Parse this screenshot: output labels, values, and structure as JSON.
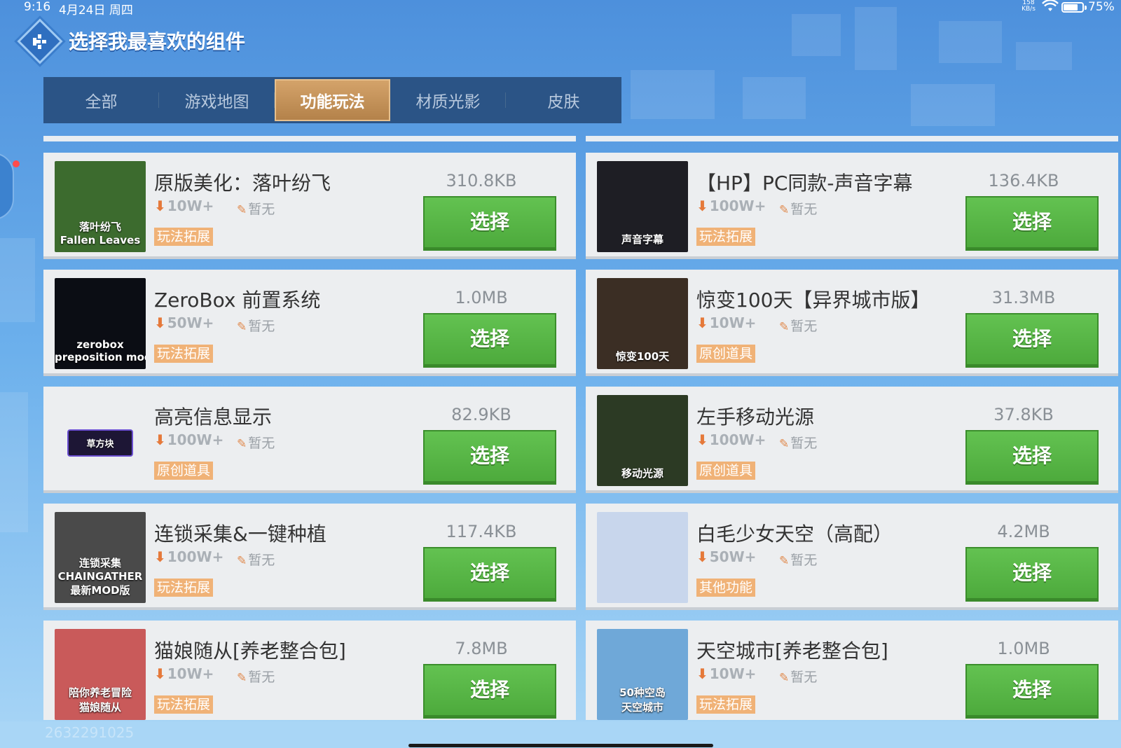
{
  "status_bar": {
    "time": "9:16",
    "date": "4月24日 周四",
    "net_speed": "158\nKB/s",
    "battery": "75%",
    "battery_level": 0.75
  },
  "header": {
    "title": "选择我最喜欢的组件"
  },
  "tabs": [
    {
      "label": "全部",
      "active": false
    },
    {
      "label": "游戏地图",
      "active": false
    },
    {
      "label": "功能玩法",
      "active": true
    },
    {
      "label": "材质光影",
      "active": false
    },
    {
      "label": "皮肤",
      "active": false
    }
  ],
  "items": [
    {
      "name": "原版美化：落叶纷飞",
      "downloads": "10W+",
      "rating": "暂无",
      "tag": "玩法拓展",
      "size": "310.8KB",
      "button": "选择",
      "thumb_caption": "落叶纷飞\nFallen Leaves",
      "thumb_color": "#3c6b2e"
    },
    {
      "name": "【HP】PC同款-声音字幕",
      "downloads": "100W+",
      "rating": "暂无",
      "tag": "玩法拓展",
      "size": "136.4KB",
      "button": "选择",
      "thumb_caption": "声音字幕",
      "thumb_color": "#1e1e24"
    },
    {
      "name": "ZeroBox 前置系统",
      "downloads": "50W+",
      "rating": "暂无",
      "tag": "玩法拓展",
      "size": "1.0MB",
      "button": "选择",
      "thumb_caption": "zerobox\npreposition mod",
      "thumb_color": "#0b0d14"
    },
    {
      "name": "惊变100天【异界城市版】",
      "downloads": "10W+",
      "rating": "暂无",
      "tag": "原创道具",
      "size": "31.3MB",
      "button": "选择",
      "thumb_caption": "惊变100天",
      "thumb_color": "#3b2e24"
    },
    {
      "name": "高亮信息显示",
      "downloads": "100W+",
      "rating": "暂无",
      "tag": "原创道具",
      "size": "82.9KB",
      "button": "选择",
      "thumb_caption": "草方块",
      "thumb_color": "#eceef0"
    },
    {
      "name": "左手移动光源",
      "downloads": "100W+",
      "rating": "暂无",
      "tag": "原创道具",
      "size": "37.8KB",
      "button": "选择",
      "thumb_caption": "移动光源",
      "thumb_color": "#2c3a24"
    },
    {
      "name": "连锁采集&一键种植",
      "downloads": "100W+",
      "rating": "暂无",
      "tag": "玩法拓展",
      "size": "117.4KB",
      "button": "选择",
      "thumb_caption": "连锁采集\nCHAINGATHER\n最新MOD版",
      "thumb_color": "#4a4a4a"
    },
    {
      "name": "白毛少女天空（高配）",
      "downloads": "50W+",
      "rating": "暂无",
      "tag": "其他功能",
      "size": "4.2MB",
      "button": "选择",
      "thumb_caption": "",
      "thumb_color": "#c8d6ec"
    },
    {
      "name": "猫娘随从[养老整合包]",
      "downloads": "10W+",
      "rating": "暂无",
      "tag": "玩法拓展",
      "size": "7.8MB",
      "button": "选择",
      "thumb_caption": "陪你养老冒险\n猫娘随从",
      "thumb_color": "#c95a5a"
    },
    {
      "name": "天空城市[养老整合包]",
      "downloads": "10W+",
      "rating": "暂无",
      "tag": "玩法拓展",
      "size": "1.0MB",
      "button": "选择",
      "thumb_caption": "50种空岛\n天空城市",
      "thumb_color": "#6fa8d8"
    }
  ],
  "watermark": "2632291025",
  "colors": {
    "accent_green": "#4daa3c",
    "tag_orange": "#f0b277",
    "tab_bar": "#2b5486",
    "tab_active": "#c4925a"
  }
}
